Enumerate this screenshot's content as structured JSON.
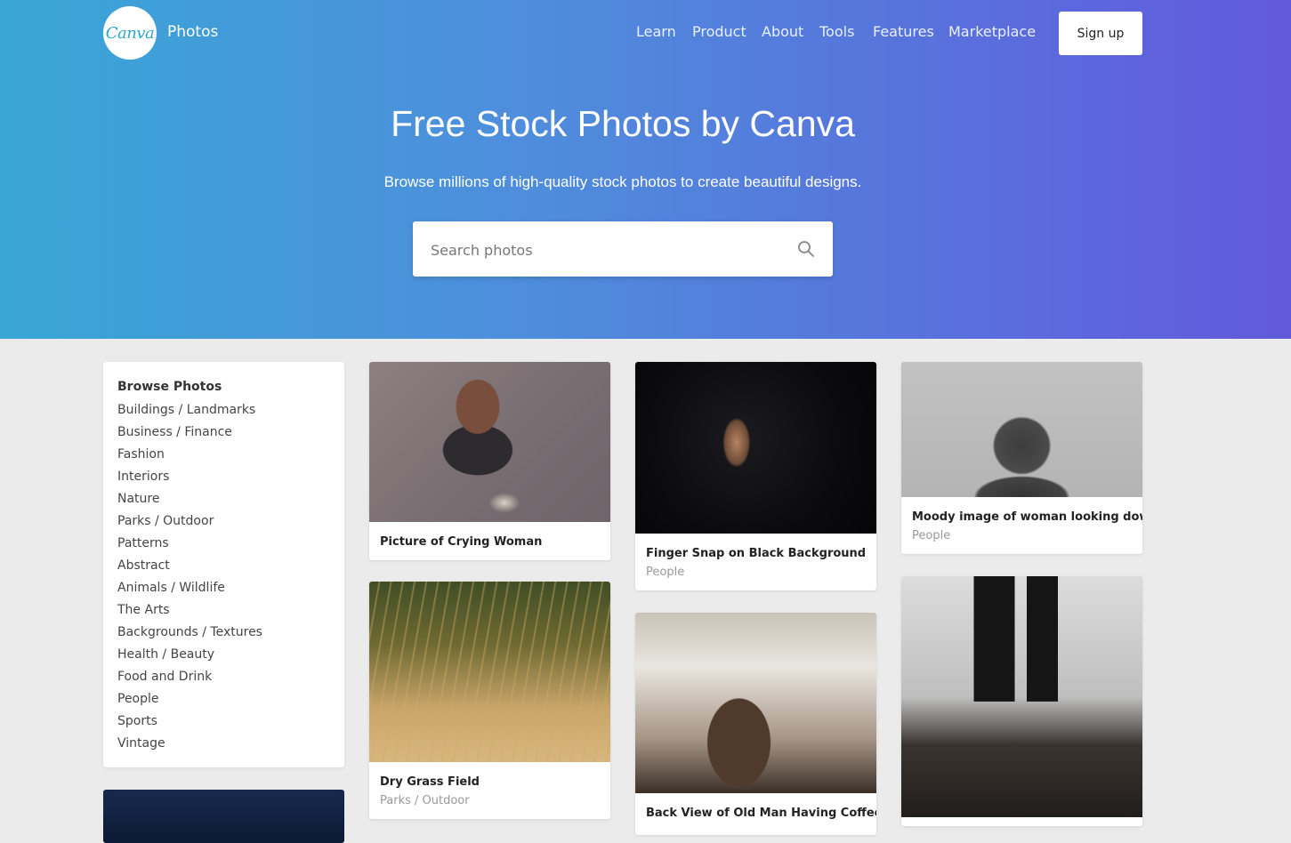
{
  "header": {
    "logo_text": "Canva",
    "brand_label": "Photos",
    "nav": [
      "Learn",
      "Product",
      "About",
      "Tools",
      "Features",
      "Marketplace"
    ],
    "signup_label": "Sign up"
  },
  "hero": {
    "title": "Free Stock Photos by Canva",
    "subtitle": "Browse millions of high-quality stock photos to create beautiful designs.",
    "search_placeholder": "Search photos"
  },
  "sidebar": {
    "title": "Browse Photos",
    "categories": [
      "Buildings / Landmarks",
      "Business / Finance",
      "Fashion",
      "Interiors",
      "Nature",
      "Parks / Outdoor",
      "Patterns",
      "Abstract",
      "Animals / Wildlife",
      "The Arts",
      "Backgrounds / Textures",
      "Health / Beauty",
      "Food and Drink",
      "People",
      "Sports",
      "Vintage"
    ]
  },
  "photos": [
    {
      "title": "Picture of Crying Woman",
      "category": ""
    },
    {
      "title": "Dry Grass Field",
      "category": "Parks / Outdoor"
    },
    {
      "title": "Finger Snap on Black Background",
      "category": "People"
    },
    {
      "title": "Back View of Old Man Having Coffee",
      "category": ""
    },
    {
      "title": "Moody image of woman looking down",
      "category": "People"
    },
    {
      "title": "",
      "category": ""
    }
  ],
  "colors": {
    "gradient_start": "#39a6d6",
    "gradient_end": "#6259dd",
    "page_bg": "#ebebeb"
  }
}
